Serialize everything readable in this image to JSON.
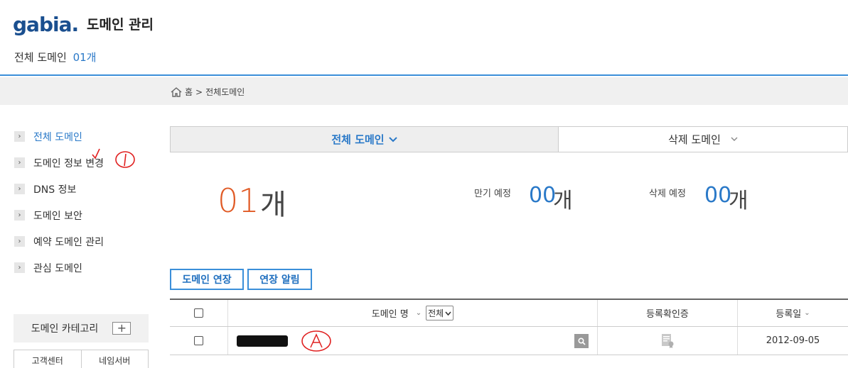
{
  "header": {
    "logo_text": "gabia",
    "logo_dot": ".",
    "title": "도메인 관리",
    "total_label": "전체 도메인",
    "total_count": "01개"
  },
  "breadcrumb": {
    "home": "홈",
    "separator": ">",
    "current": "전체도메인"
  },
  "sidebar": {
    "items": [
      {
        "label": "전체 도메인",
        "active": true
      },
      {
        "label": "도메인 정보 변경"
      },
      {
        "label": "DNS 정보"
      },
      {
        "label": "도메인 보안"
      },
      {
        "label": "예약 도메인 관리"
      },
      {
        "label": "관심 도메인"
      }
    ],
    "category_label": "도메인 카테고리",
    "category_add": "+",
    "bottom_tabs": [
      "고객센터",
      "네임서버"
    ]
  },
  "tabs": {
    "all": "전체 도메인",
    "deleted": "삭제 도메인"
  },
  "stats": {
    "total_num": "01",
    "total_unit": "개",
    "expiring_label": "만기 예정",
    "expiring_num": "00",
    "expiring_unit": "개",
    "deleting_label": "삭제 예정",
    "deleting_num": "00",
    "deleting_unit": "개"
  },
  "actions": {
    "extend": "도메인 연장",
    "notify": "연장 알림"
  },
  "table": {
    "col_name": "도메인 명",
    "filter_value": "전체",
    "col_cert": "등록확인증",
    "col_date": "등록일",
    "rows": [
      {
        "date": "2012-09-05"
      }
    ]
  },
  "colors": {
    "accent": "#2a79c8",
    "highlight": "#e05a25",
    "annotation": "#e02020"
  }
}
